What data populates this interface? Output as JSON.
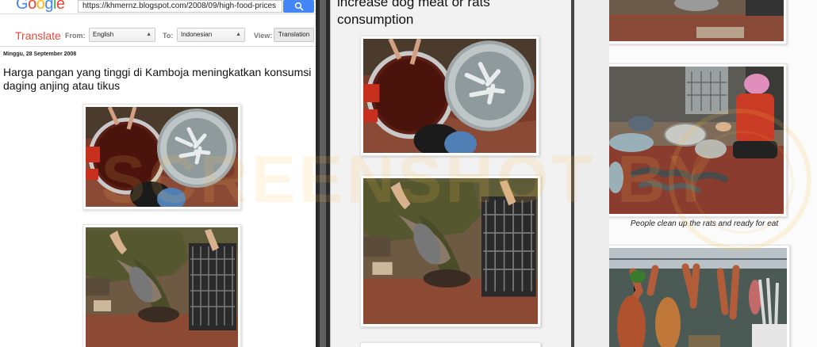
{
  "left_panel": {
    "logo": {
      "letters": [
        "G",
        "o",
        "o",
        "g",
        "l",
        "e"
      ],
      "colors": [
        "#4285f4",
        "#ea4335",
        "#fbbc05",
        "#4285f4",
        "#34a853",
        "#ea4335"
      ]
    },
    "url": "https://khmernz.blogspot.com/2008/09/high-food-prices",
    "search_icon": "search-icon",
    "translate_bar": {
      "title": "Translate",
      "from_label": "From:",
      "from_value": "English",
      "to_label": "To:",
      "to_value": "Indonesian",
      "view_label": "View:",
      "view_button": "Translation"
    },
    "post_date": "Minggu, 28 September 2008",
    "post_title": "Harga pangan yang tinggi di Kamboja meningkatkan konsumsi daging anjing atau tikus"
  },
  "middle_panel": {
    "title": "increase dog meat or rats consumption"
  },
  "right_panel": {
    "caption": "People clean up the rats and ready for eat"
  },
  "colors": {
    "accent_blue": "#4486f6",
    "translate_red": "#dd4b39"
  }
}
